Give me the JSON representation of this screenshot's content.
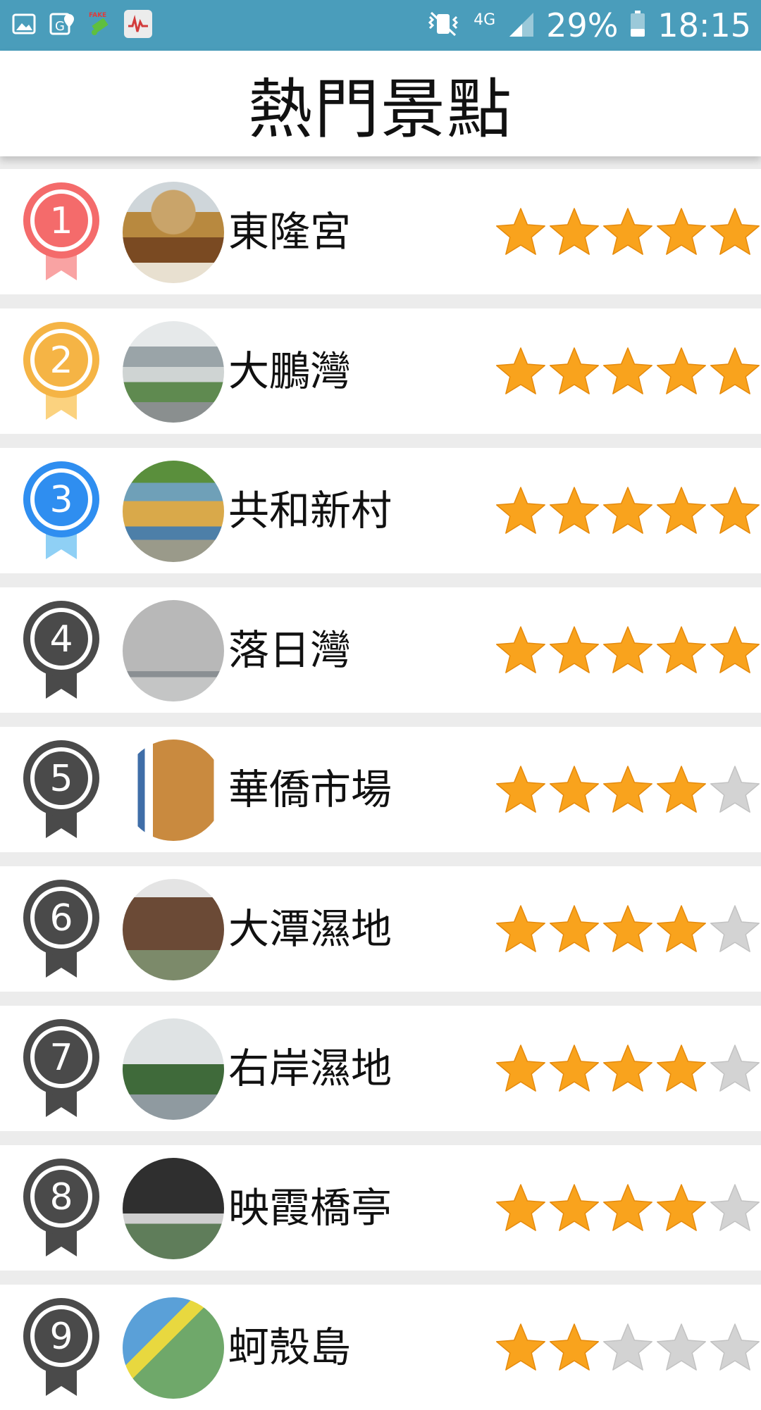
{
  "status_bar": {
    "battery": "29%",
    "time": "18:15",
    "network": "4G",
    "icons": [
      "gallery-icon",
      "maps-icon",
      "fake-gps-icon",
      "app-notification-icon",
      "vibrate-icon",
      "signal-icon",
      "battery-icon"
    ]
  },
  "header": {
    "title": "熱門景點"
  },
  "colors": {
    "status_bar_bg": "#4a9dbb",
    "medal_1": "#f46b6b",
    "medal_2": "#f5b445",
    "medal_3": "#2f8ef0",
    "medal_other": "#4a4a4a",
    "star_filled": "#f9a31d",
    "star_empty": "#d3d3d3"
  },
  "attractions": [
    {
      "rank": "1",
      "name": "東隆宮",
      "rating": 5,
      "rating_max": 5
    },
    {
      "rank": "2",
      "name": "大鵬灣",
      "rating": 5,
      "rating_max": 5
    },
    {
      "rank": "3",
      "name": "共和新村",
      "rating": 5,
      "rating_max": 5
    },
    {
      "rank": "4",
      "name": "落日灣",
      "rating": 5,
      "rating_max": 5
    },
    {
      "rank": "5",
      "name": "華僑市場",
      "rating": 4,
      "rating_max": 5
    },
    {
      "rank": "6",
      "name": "大潭濕地",
      "rating": 4,
      "rating_max": 5
    },
    {
      "rank": "7",
      "name": "右岸濕地",
      "rating": 4,
      "rating_max": 5
    },
    {
      "rank": "8",
      "name": "映霞橋亭",
      "rating": 4,
      "rating_max": 5
    },
    {
      "rank": "9",
      "name": "蚵殼島",
      "rating": 2,
      "rating_max": 5
    }
  ]
}
